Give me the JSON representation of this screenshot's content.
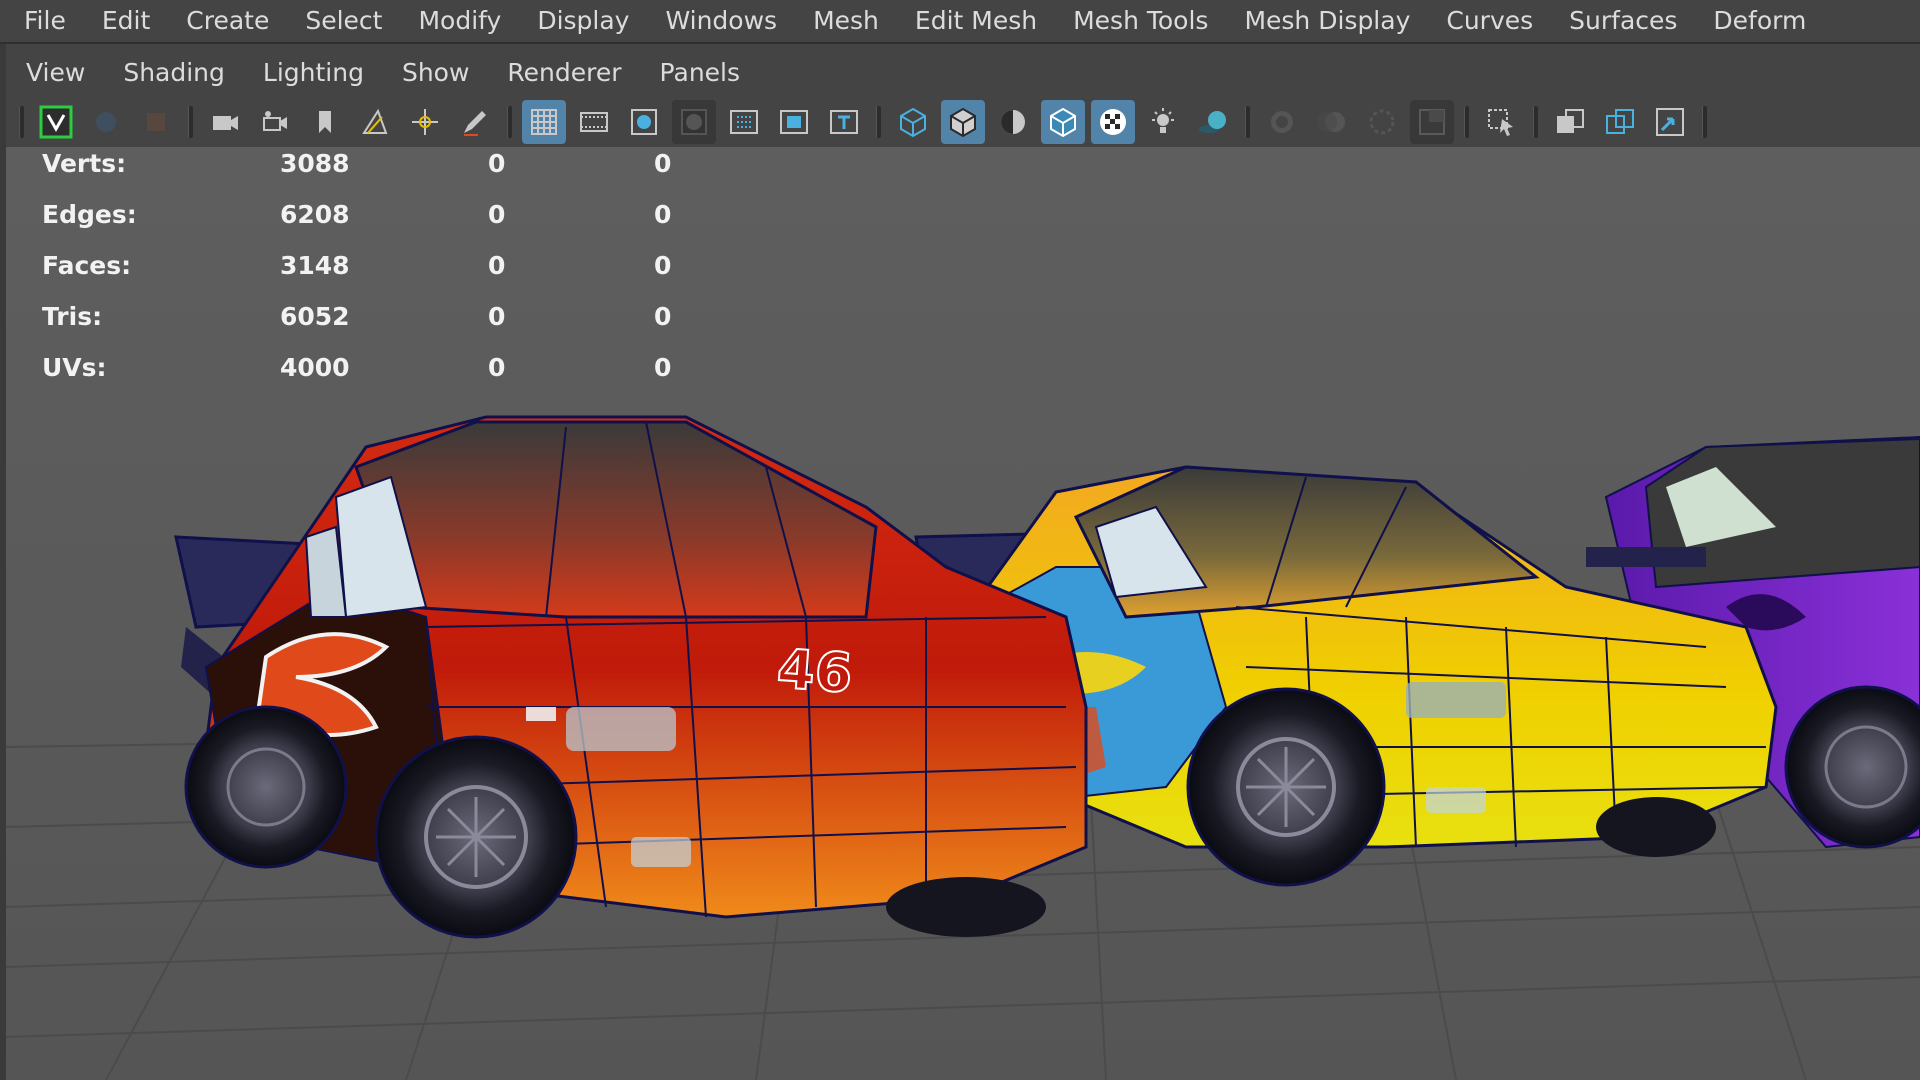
{
  "main_menu": [
    "File",
    "Edit",
    "Create",
    "Select",
    "Modify",
    "Display",
    "Windows",
    "Mesh",
    "Edit Mesh",
    "Mesh Tools",
    "Mesh Display",
    "Curves",
    "Surfaces",
    "Deform"
  ],
  "panel_menu": [
    "View",
    "Shading",
    "Lighting",
    "Show",
    "Renderer",
    "Panels"
  ],
  "hud": [
    {
      "label": "Verts:",
      "v1": "3088",
      "v2": "0",
      "v3": "0"
    },
    {
      "label": "Edges:",
      "v1": "6208",
      "v2": "0",
      "v3": "0"
    },
    {
      "label": "Faces:",
      "v1": "3148",
      "v2": "0",
      "v3": "0"
    },
    {
      "label": "Tris:",
      "v1": "6052",
      "v2": "0",
      "v3": "0"
    },
    {
      "label": "UVs:",
      "v1": "4000",
      "v2": "0",
      "v3": "0"
    }
  ],
  "car_number": "46",
  "colors": {
    "accent_blue": "#5283a8",
    "highlight_green": "#2ecc40",
    "wire": "#1a1a6a",
    "viewport_bg": "#5b5b5b"
  },
  "toolbar_icons": [
    "select-camera-icon",
    "lock-camera-icon",
    "camera-attributes-icon",
    "camera-icon",
    "camera-move-icon",
    "bookmark-icon",
    "image-plane-icon",
    "2d-pan-zoom-icon",
    "grease-pencil-icon",
    "grid-icon",
    "film-gate-icon",
    "resolution-gate-icon",
    "gate-mask-icon",
    "field-chart-icon",
    "safe-action-icon",
    "safe-title-icon",
    "wireframe-icon",
    "smooth-shade-icon",
    "use-default-material-icon",
    "wireframe-on-shaded-icon",
    "textured-icon",
    "use-all-lights-icon",
    "shadows-icon",
    "screen-space-ao-icon",
    "motion-blur-icon",
    "anti-aliasing-icon",
    "depth-of-field-icon",
    "isolate-select-icon",
    "xray-icon",
    "xray-joints-icon",
    "xray-active-icon"
  ]
}
